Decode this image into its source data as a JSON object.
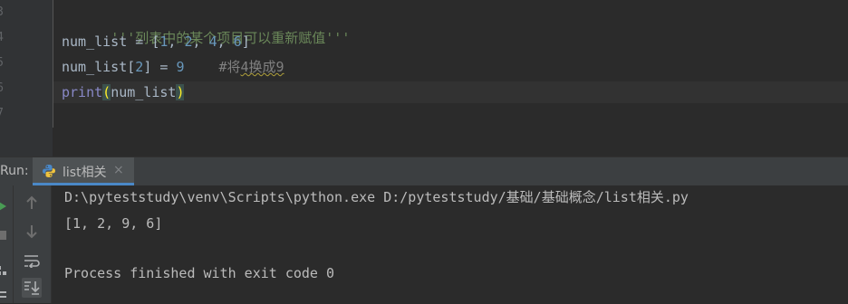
{
  "editor": {
    "line_numbers": [
      "3",
      "4",
      "5",
      "6",
      "7"
    ],
    "lines": {
      "l1_docstring": "'''列表中的某个项目可以重新赋值'''",
      "l2_var": "num_list = [",
      "l2_n1": "1",
      "l2_sep1": ", ",
      "l2_n2": "2",
      "l2_sep2": ", ",
      "l2_n3": "4",
      "l2_sep3": ", ",
      "l2_n4": "6",
      "l2_end": "]",
      "l3_assign": "num_list[",
      "l3_index": "2",
      "l3_mid": "] = ",
      "l3_value": "9",
      "l3_comment_hash": "#将",
      "l3_comment_rest": "4换成9",
      "l4_func": "print",
      "l4_open": "(",
      "l4_arg": "num_list",
      "l4_close": ")"
    }
  },
  "run_panel": {
    "label": "Run:",
    "tab_label": "list相关",
    "tab_close": "×"
  },
  "console": {
    "lines": [
      "D:\\pyteststudy\\venv\\Scripts\\python.exe D:/pyteststudy/基础/基础概念/list相关.py",
      "[1, 2, 9, 6]",
      "",
      "Process finished with exit code 0"
    ]
  },
  "icons": {
    "rerun": "run-icon",
    "stop": "stop-icon",
    "up": "up-arrow-icon",
    "down": "down-arrow-icon",
    "soft_wrap": "soft-wrap-icon",
    "scroll_end": "scroll-to-end-icon",
    "python": "python-icon"
  },
  "colors": {
    "editor_bg": "#2b2b2b",
    "panel_bg": "#3c3f41",
    "string": "#6a8759",
    "number": "#6897bb",
    "builtin": "#8888c6",
    "comment": "#808080",
    "text": "#a9b7c6",
    "tab_underline": "#4a88c7"
  }
}
